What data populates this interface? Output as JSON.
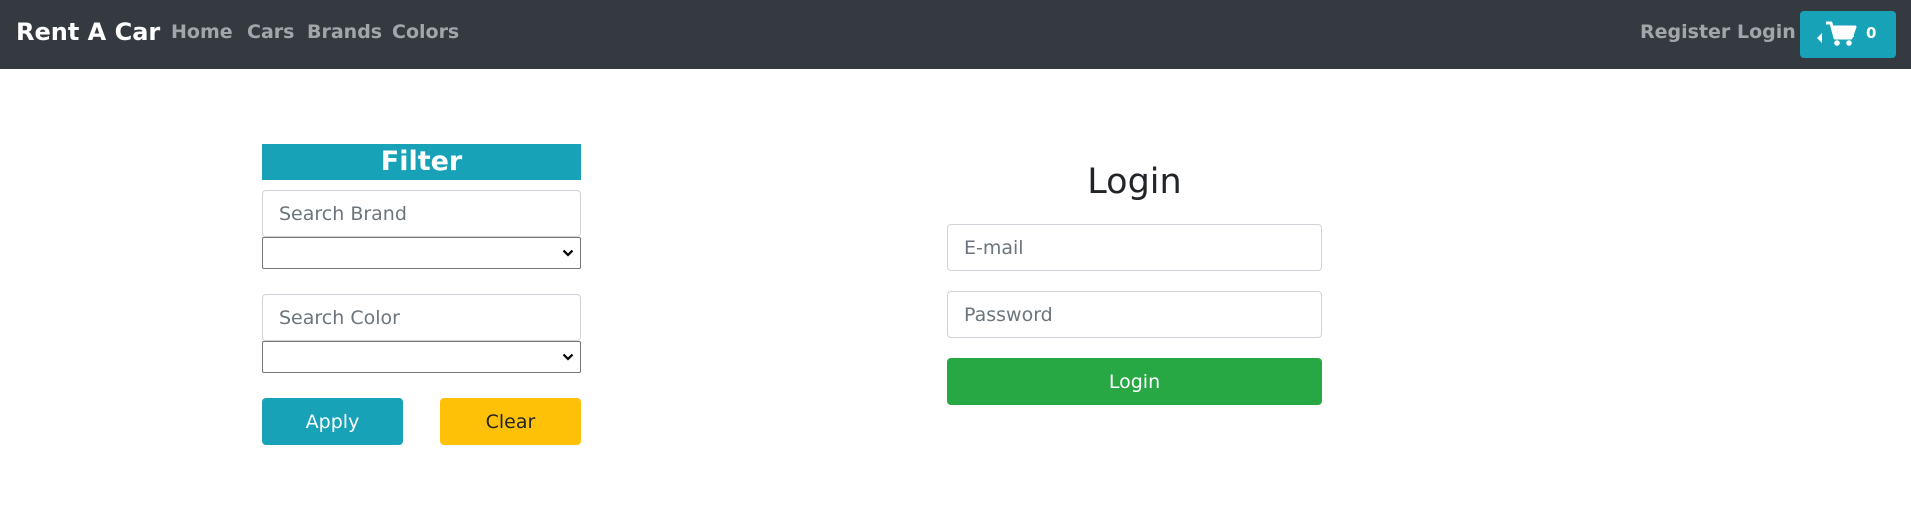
{
  "navbar": {
    "brand": "Rent A Car",
    "links": [
      "Home",
      "Cars",
      "Brands",
      "Colors"
    ],
    "register": "Register",
    "login": "Login",
    "cart_icon": "shopping-cart-icon",
    "cart_count": "0"
  },
  "filter": {
    "title": "Filter",
    "brand_placeholder": "Search Brand",
    "brand_selected": "",
    "color_placeholder": "Search Color",
    "color_selected": "",
    "apply_label": "Apply",
    "clear_label": "Clear"
  },
  "login_form": {
    "title": "Login",
    "email_placeholder": "E-mail",
    "password_placeholder": "Password",
    "submit_label": "Login"
  },
  "colors": {
    "navbar_bg": "#343a40",
    "info": "#17a2b8",
    "warning": "#ffc107",
    "success": "#28a745"
  }
}
